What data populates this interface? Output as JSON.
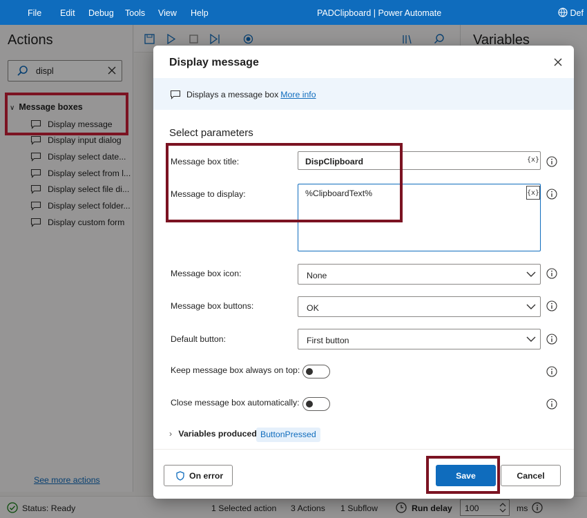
{
  "titlebar": {
    "menu": [
      "File",
      "Edit",
      "Debug",
      "Tools",
      "View",
      "Help"
    ],
    "title": "PADClipboard | Power Automate",
    "env": "Def"
  },
  "actions_pane": {
    "title": "Actions",
    "search_value": "displ",
    "group": "Message boxes",
    "items": [
      "Display message",
      "Display input dialog",
      "Display select date...",
      "Display select from l...",
      "Display select file di...",
      "Display select folder...",
      "Display custom form"
    ],
    "see_more": "See more actions"
  },
  "variables_pane": {
    "title": "Variables"
  },
  "statusbar": {
    "status": "Status: Ready",
    "selected": "1 Selected action",
    "actions": "3 Actions",
    "subflow": "1 Subflow",
    "run_delay_label": "Run delay",
    "run_delay_value": "100",
    "run_delay_unit": "ms"
  },
  "dialog": {
    "title": "Display message",
    "info_text": "Displays a message box",
    "info_link": "More info",
    "section_title": "Select parameters",
    "var_button": "{x}",
    "params": {
      "title_label": "Message box title:",
      "title_value": "DispClipboard",
      "message_label": "Message to display:",
      "message_value": "%ClipboardText%",
      "icon_label": "Message box icon:",
      "icon_value": "None",
      "buttons_label": "Message box buttons:",
      "buttons_value": "OK",
      "default_label": "Default button:",
      "default_value": "First button",
      "ontop_label": "Keep message box always on top:",
      "autoclose_label": "Close message box automatically:"
    },
    "ontop_enabled": false,
    "autoclose_enabled": false,
    "variables_produced_label": "Variables produced",
    "variables_produced": [
      "ButtonPressed"
    ],
    "on_error": "On error",
    "save": "Save",
    "cancel": "Cancel"
  },
  "colors": {
    "accent": "#0f6cbd",
    "highlight": "#7b1322"
  }
}
